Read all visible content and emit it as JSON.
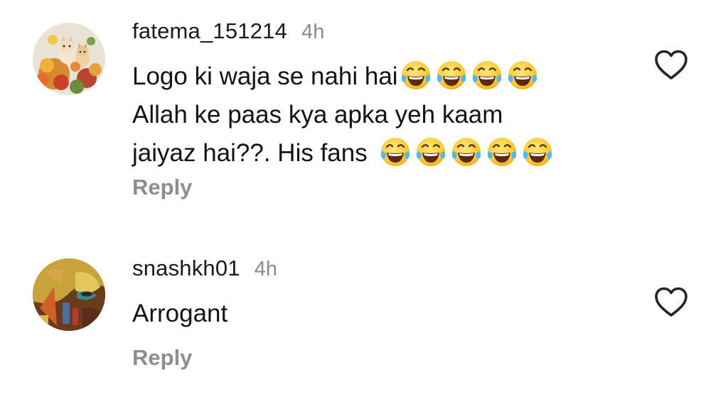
{
  "comments": [
    {
      "username": "fatema_151214",
      "time": "4h",
      "lines": [
        "Logo ki waja se nahi hai",
        "Allah ke paas kya apka yeh kaam",
        "jaiyaz hai??. His fans"
      ],
      "emoji_line1": "face-with-tears-of-joy x4",
      "emoji_line3": "face-with-tears-of-joy x5",
      "reply_label": "Reply",
      "like_icon": "heart-outline-icon"
    },
    {
      "username": "snashkh01",
      "time": "4h",
      "lines": [
        "Arrogant"
      ],
      "reply_label": "Reply",
      "like_icon": "heart-outline-icon"
    }
  ],
  "colors": {
    "background": "#ffffff",
    "username": "#1a1a1a",
    "text": "#141414",
    "muted": "#8e8e8e",
    "heart_stroke": "#262626",
    "emoji_face": "#FFCC33"
  }
}
